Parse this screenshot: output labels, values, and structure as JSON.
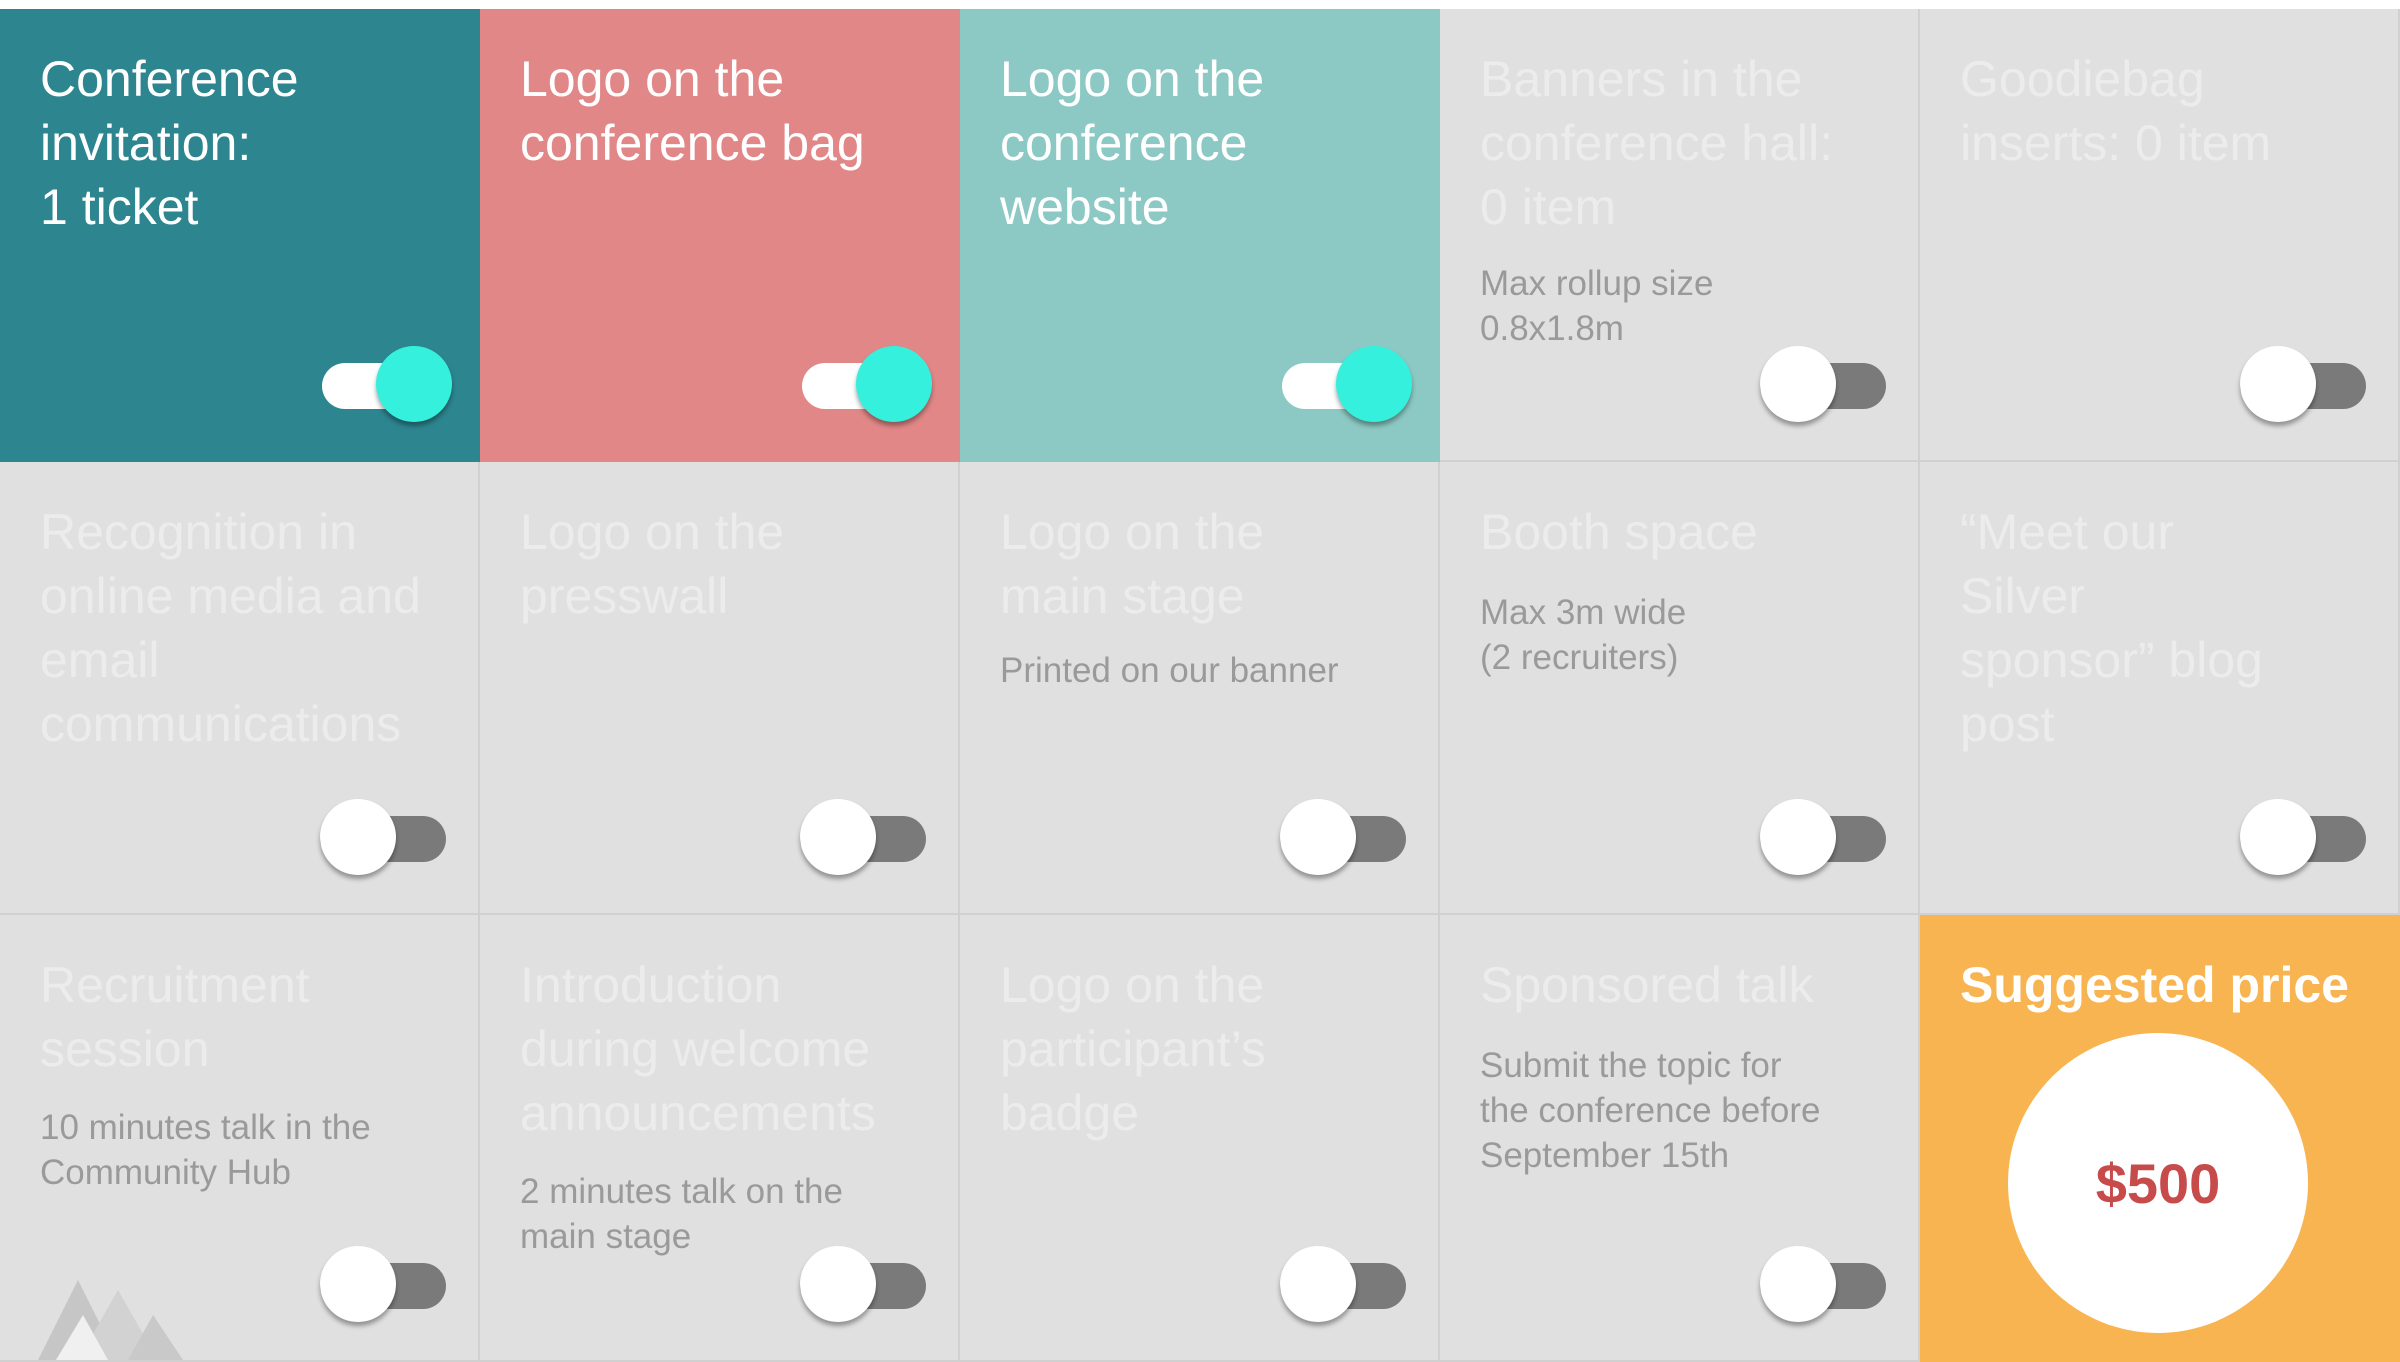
{
  "colors": {
    "tile_off": "#e0e0e0",
    "tile_on_1": "#2d8590",
    "tile_on_2": "#e28787",
    "tile_on_3": "#8cc9c4",
    "price_tile": "#f8b451",
    "toggle_on_knob": "#35f0dc",
    "toggle_off_track": "#7a7a7a",
    "price_text": "#c74b4b"
  },
  "tiles": [
    {
      "title": "Conference\ninvitation:\n1 ticket",
      "subtitle": "",
      "enabled": true
    },
    {
      "title": "Logo on the\nconference bag",
      "subtitle": "",
      "enabled": true
    },
    {
      "title": "Logo on the\nconference\nwebsite",
      "subtitle": "",
      "enabled": true
    },
    {
      "title": "Banners in the\nconference hall:\n0 item",
      "subtitle": "Max rollup size\n0.8x1.8m",
      "enabled": false
    },
    {
      "title": "Goodiebag\ninserts: 0 item",
      "subtitle": "",
      "enabled": false
    },
    {
      "title": "Recognition in\nonline media and\nemail\ncommunications",
      "subtitle": "",
      "enabled": false
    },
    {
      "title": "Logo on the\npresswall",
      "subtitle": "",
      "enabled": false
    },
    {
      "title": "Logo on the\nmain stage",
      "subtitle": "Printed on our banner",
      "enabled": false
    },
    {
      "title": "Booth space",
      "subtitle": "Max 3m wide\n(2 recruiters)",
      "enabled": false
    },
    {
      "title": "“Meet our\nSilver\nsponsor” blog\npost",
      "subtitle": "",
      "enabled": false
    },
    {
      "title": "Recruitment\nsession",
      "subtitle": "10 minutes talk in the\nCommunity Hub",
      "enabled": false
    },
    {
      "title": "Introduction\nduring welcome\nannouncements",
      "subtitle": "2 minutes talk on the\nmain stage",
      "enabled": false
    },
    {
      "title": "Logo on the\nparticipant’s\nbadge",
      "subtitle": "",
      "enabled": false
    },
    {
      "title": "Sponsored talk",
      "subtitle": "Submit the topic for\nthe conference before\nSeptember 15th",
      "enabled": false
    }
  ],
  "price": {
    "label": "Suggested price",
    "value": "$500"
  }
}
